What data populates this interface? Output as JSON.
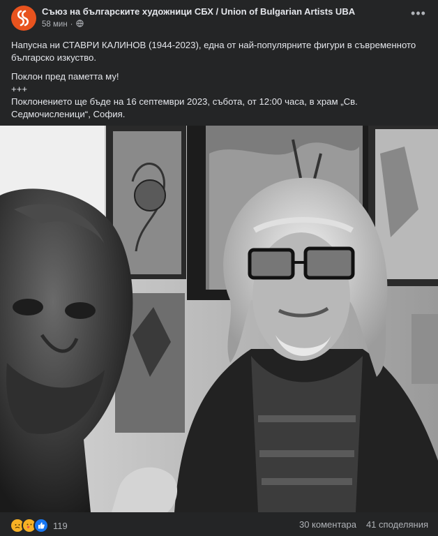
{
  "post": {
    "page_name": "Съюз на българските художници СБХ / Union of Bulgarian Artists UBA",
    "time": "58 мин",
    "audience_icon": "globe-icon",
    "more_icon": "more-horizontal-icon",
    "paragraphs": [
      "Напусна ни СТАВРИ КАЛИНОВ (1944-2023), една от най-популярните фигури в съвременното българско изкуство.",
      "Поклон пред паметта му!\n+++\nПоклонението ще бъде на 16 септември 2023, събота, от 12:00 часа, в храм „Св. Седмочисленици“, София."
    ]
  },
  "reactions": {
    "icons": [
      "sad-icon",
      "care-icon",
      "like-icon"
    ],
    "count": "119",
    "comments": "30 коментара",
    "shares": "41 споделяния"
  }
}
